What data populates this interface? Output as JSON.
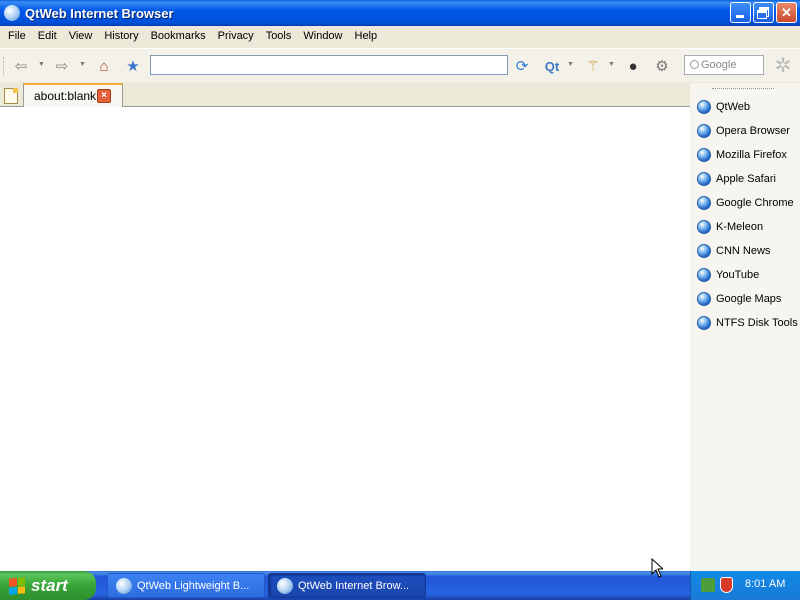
{
  "window": {
    "title": "QtWeb Internet Browser"
  },
  "menu": [
    "File",
    "Edit",
    "View",
    "History",
    "Bookmarks",
    "Privacy",
    "Tools",
    "Window",
    "Help"
  ],
  "toolbar": {
    "address_value": "",
    "search_placeholder": "Google"
  },
  "tabs": [
    {
      "label": "about:blank",
      "close": "×"
    }
  ],
  "bookmarks": [
    "QtWeb",
    "Opera Browser",
    "Mozilla Firefox",
    "Apple Safari",
    "Google Chrome",
    "K-Meleon",
    "CNN News",
    "YouTube",
    "Google Maps",
    "NTFS Disk Tools"
  ],
  "taskbar": {
    "start_label": "start",
    "tasks": [
      "QtWeb Lightweight B...",
      "QtWeb Internet Brow..."
    ],
    "clock": "8:01 AM"
  },
  "colors": {
    "titlebar": "#0058E6",
    "tab_accent": "#F3A93C",
    "start_button": "#37A437",
    "taskbar": "#2663E0"
  }
}
